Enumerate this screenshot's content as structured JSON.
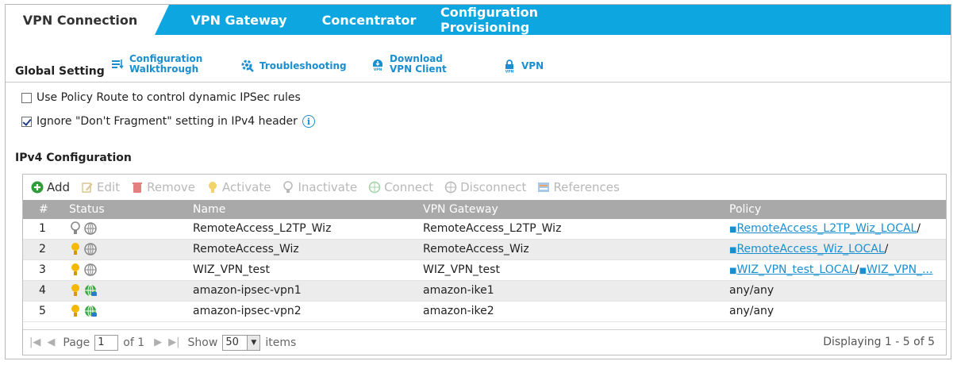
{
  "tabs": [
    {
      "label": "VPN Connection",
      "active": true
    },
    {
      "label": "VPN Gateway"
    },
    {
      "label": "Concentrator"
    },
    {
      "label": "Configuration Provisioning"
    }
  ],
  "global": {
    "title": "Global Setting",
    "links": [
      {
        "line1": "Configuration",
        "line2": "Walkthrough",
        "icon": "walkthrough-icon"
      },
      {
        "line1": "Troubleshooting",
        "icon": "troubleshoot-gear-icon"
      },
      {
        "line1": "Download",
        "line2": "VPN Client",
        "icon": "download-vpn-icon"
      },
      {
        "line1": "VPN",
        "icon": "vpn-lock-icon"
      }
    ]
  },
  "options": {
    "policy_route": {
      "label": "Use Policy Route to control dynamic IPSec rules",
      "checked": false
    },
    "ignore_df": {
      "label": "Ignore \"Don't Fragment\" setting in IPv4 header",
      "checked": true
    }
  },
  "ipv4": {
    "title": "IPv4 Configuration",
    "toolbar": {
      "add": "Add",
      "edit": "Edit",
      "remove": "Remove",
      "activate": "Activate",
      "inactivate": "Inactivate",
      "connect": "Connect",
      "disconnect": "Disconnect",
      "references": "References"
    },
    "columns": {
      "num": "#",
      "status": "Status",
      "name": "Name",
      "gateway": "VPN Gateway",
      "policy": "Policy"
    },
    "rows": [
      {
        "num": "1",
        "name": "RemoteAccess_L2TP_Wiz",
        "gateway": "RemoteAccess_L2TP_Wiz",
        "policy_a": "RemoteAccess_L2TP_Wiz_LOCAL",
        "policy_sep": "/",
        "policy_b": "",
        "active": false,
        "connected": false
      },
      {
        "num": "2",
        "name": "RemoteAccess_Wiz",
        "gateway": "RemoteAccess_Wiz",
        "policy_a": "RemoteAccess_Wiz_LOCAL",
        "policy_sep": "/",
        "policy_b": "",
        "active": true,
        "connected": false
      },
      {
        "num": "3",
        "name": "WIZ_VPN_test",
        "gateway": "WIZ_VPN_test",
        "policy_a": "WIZ_VPN_test_LOCAL",
        "policy_sep": "/",
        "policy_b": "WIZ_VPN_...",
        "active": true,
        "connected": false
      },
      {
        "num": "4",
        "name": "amazon-ipsec-vpn1",
        "gateway": "amazon-ike1",
        "policy_text": "any/any",
        "active": true,
        "connected": true
      },
      {
        "num": "5",
        "name": "amazon-ipsec-vpn2",
        "gateway": "amazon-ike2",
        "policy_text": "any/any",
        "active": true,
        "connected": true
      }
    ],
    "pager": {
      "page_label": "Page",
      "page_value": "1",
      "of_label": "of 1",
      "show_label": "Show",
      "show_value": "50",
      "items_label": "items",
      "displaying": "Displaying 1 - 5 of 5"
    }
  },
  "colors": {
    "accent": "#0da6e0",
    "link": "#1a8fd0",
    "bulb_on": "#f5b800",
    "bulb_off": "#9a9a9a",
    "globe_on": "#3aa845"
  }
}
